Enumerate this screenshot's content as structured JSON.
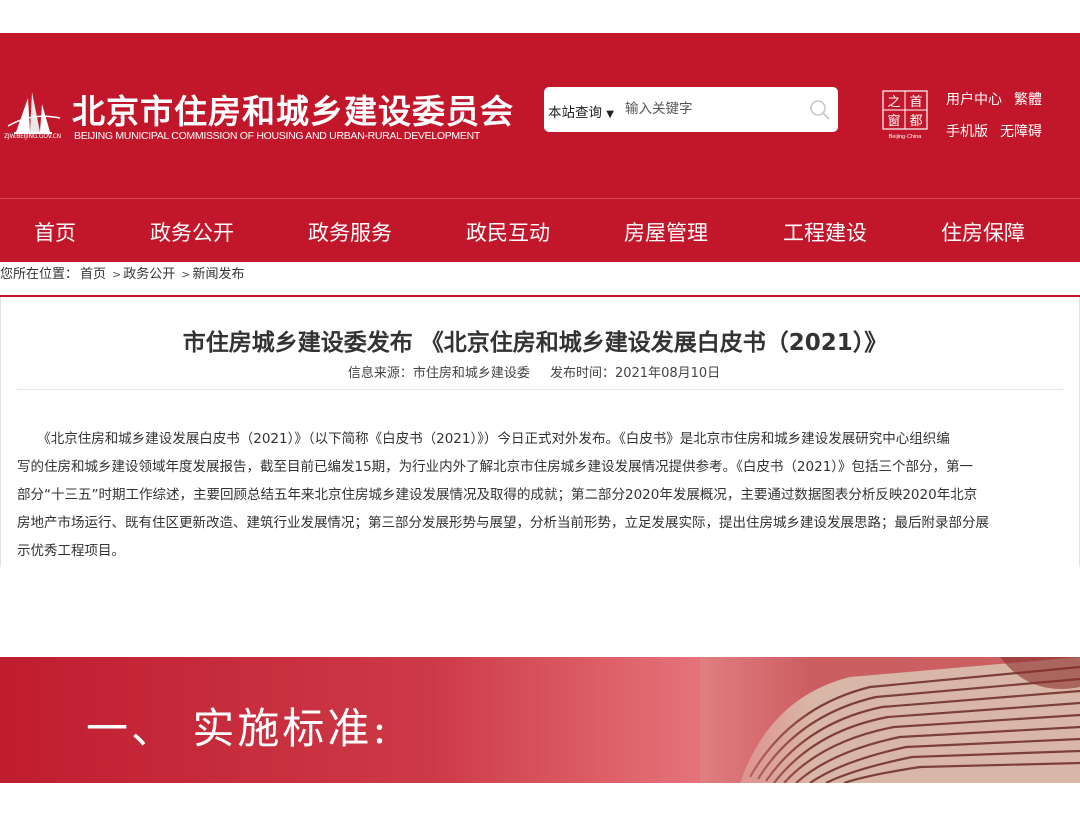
{
  "header": {
    "logo_domain": "ZJW.BEIJING.GOV.CN",
    "site_title": "北京市住房和城乡建设委员会",
    "site_subtitle": "BEIJING MUNICIPAL COMMISSION OF HOUSING AND URBAN-RURAL DEVELOPMENT",
    "search": {
      "scope_label": "本站查询",
      "placeholder": "输入关键字"
    },
    "capital_logo": {
      "chars": [
        "之",
        "首",
        "窗",
        "都"
      ],
      "caption": "Beijing·China"
    },
    "links": {
      "user_center": "用户中心",
      "traditional": "繁體",
      "mobile": "手机版",
      "accessibility": "无障碍"
    },
    "colors": {
      "brand_red": "#c2162b"
    }
  },
  "nav": {
    "items": [
      "首页",
      "政务公开",
      "政务服务",
      "政民互动",
      "房屋管理",
      "工程建设",
      "住房保障"
    ]
  },
  "breadcrumb": {
    "prefix": "您所在位置：",
    "items": [
      "首页",
      "政务公开",
      "新闻发布"
    ],
    "separator": ">"
  },
  "article": {
    "title": "市住房城乡建设委发布 《北京住房和城乡建设发展白皮书（2021）》",
    "source": "信息来源：市住房和城乡建设委",
    "publish_time": "发布时间：2021年08月10日",
    "paragraph_lines": [
      "　　《北京住房和城乡建设发展白皮书（2021）》（以下简称《白皮书（2021）》）今日正式对外发布。《白皮书》是北京市住房和城乡建设发展研究中心组织编",
      "写的住房和城乡建设领域年度发展报告，截至目前已编发15期，为行业内外了解北京市住房城乡建设发展情况提供参考。《白皮书（2021）》包括三个部分，第一",
      "部分“十三五”时期工作综述，主要回顾总结五年来北京住房城乡建设发展情况及取得的成就；第二部分2020年发展概况，主要通过数据图表分析反映2020年北京",
      "房地产市场运行、既有住区更新改造、建筑行业发展情况；第三部分发展形势与展望，分析当前形势，立足发展实际，提出住房城乡建设发展思路；最后附录部分展",
      "示优秀工程项目。"
    ]
  },
  "banner": {
    "title": "一、 实施标准:"
  }
}
